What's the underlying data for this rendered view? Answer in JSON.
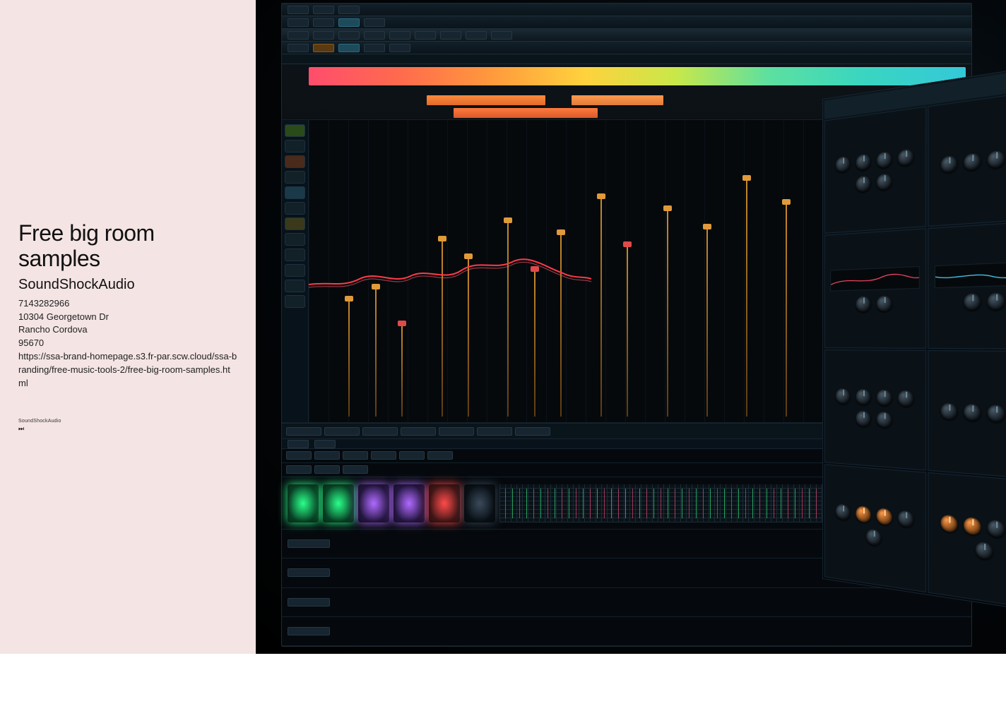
{
  "left": {
    "title": "Free big room samples",
    "brand": "SoundShockAudio",
    "phone": "7143282966",
    "street": "10304 Georgetown Dr",
    "city": "Rancho Cordova",
    "zip": "95670",
    "url": "https://ssa-brand-homepage.s3.fr-par.scw.cloud/ssa-branding/free-music-tools-2/free-big-room-samples.html",
    "footer_brand": "SoundShockAudio",
    "footer_icon": "⏭"
  }
}
